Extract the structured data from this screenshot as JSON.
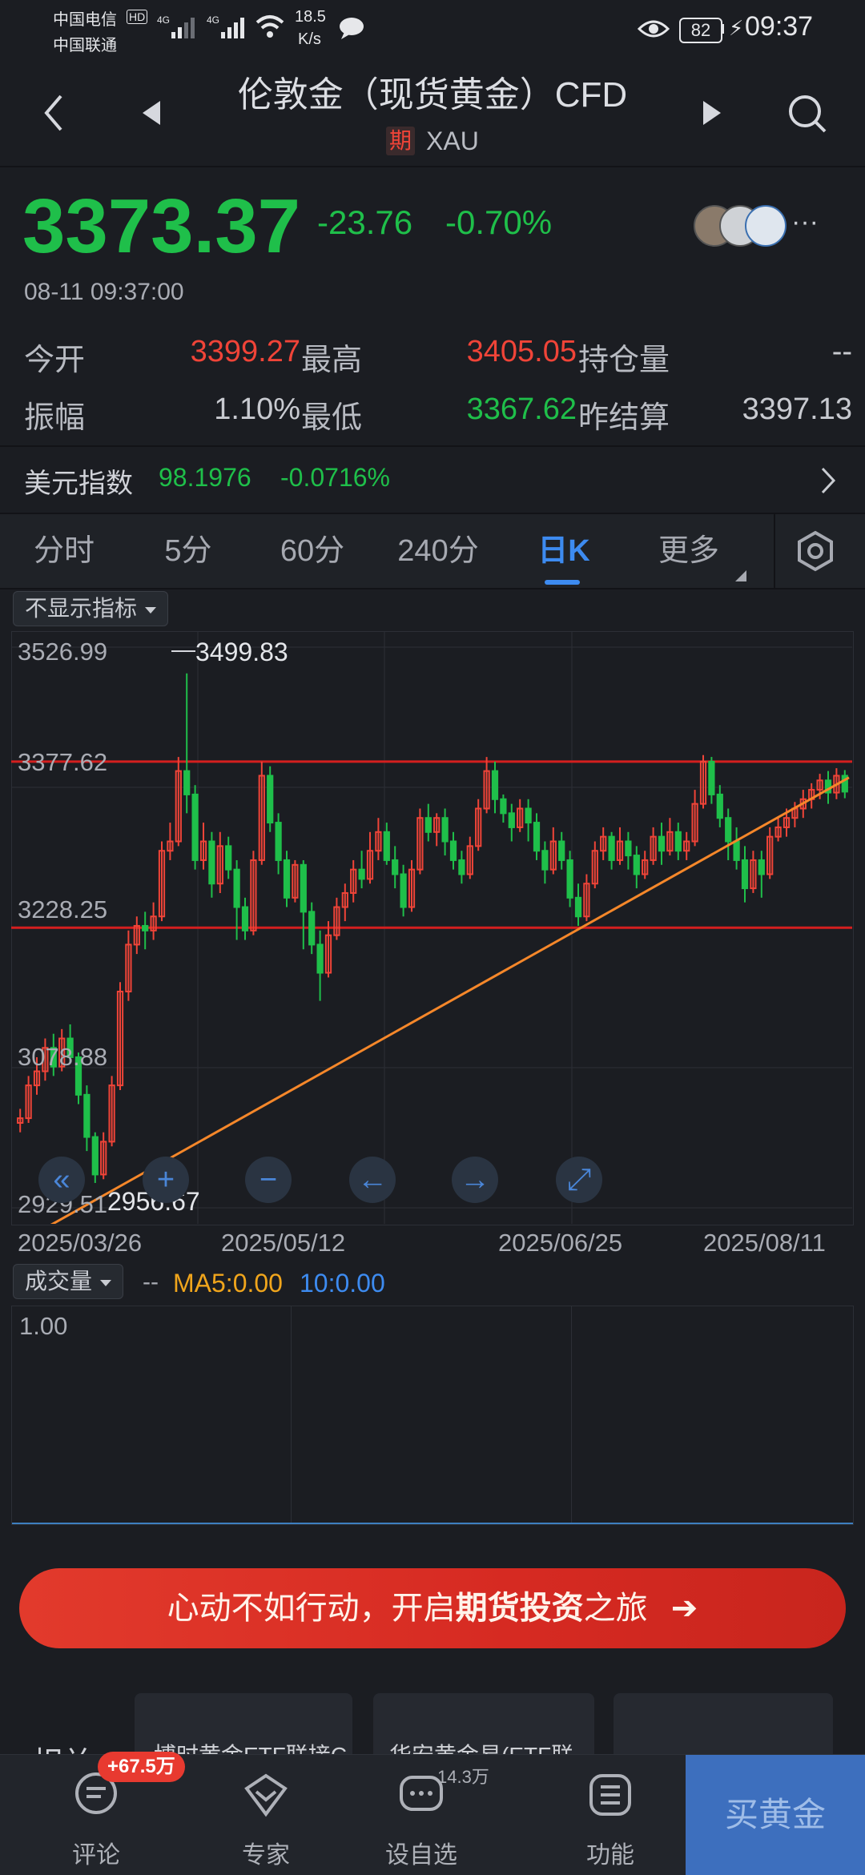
{
  "status_bar": {
    "carrier1": "中国电信",
    "carrier2": "中国联通",
    "hd": "HD",
    "net1": "4G",
    "net2": "4G",
    "speed_value": "18.5",
    "speed_unit": "K/s",
    "battery": "82",
    "time": "09:37"
  },
  "header": {
    "title": "伦敦金（现货黄金）CFD",
    "badge": "期",
    "code": "XAU"
  },
  "quote": {
    "price": "3373.37",
    "change": "-23.76",
    "change_pct": "-0.70%",
    "timestamp": "08-11 09:37:00",
    "more": "···",
    "stats": [
      {
        "label": "今开",
        "value": "3399.27",
        "color": "#f04438"
      },
      {
        "label": "最高",
        "value": "3405.05",
        "color": "#f04438"
      },
      {
        "label": "持仓量",
        "value": "--",
        "color": "#c8cad0"
      },
      {
        "label": "振幅",
        "value": "1.10%",
        "color": "#c8cad0"
      },
      {
        "label": "最低",
        "value": "3367.62",
        "color": "#1fbf4a"
      },
      {
        "label": "昨结算",
        "value": "3397.13",
        "color": "#c8cad0"
      }
    ]
  },
  "usd_index": {
    "label": "美元指数",
    "value": "98.1976",
    "change": "-0.0716%"
  },
  "tabs": [
    "分时",
    "5分",
    "60分",
    "240分",
    "日K",
    "更多"
  ],
  "active_tab": "日K",
  "indicator_select": "不显示指标",
  "chart_data": {
    "type": "candlestick",
    "ylim": [
      2929.51,
      3526.99
    ],
    "y_ticks": [
      "3526.99",
      "3377.62",
      "3228.25",
      "3078.88",
      "2929.51"
    ],
    "x_ticks": [
      "2025/03/26",
      "2025/05/12",
      "2025/06/25",
      "2025/08/11"
    ],
    "max_label": "3499.83",
    "min_label": "2956.67",
    "resistance": 3405,
    "support": 3228,
    "up_color": "#f04438",
    "down_color": "#1fbf4a",
    "trendline_color": "#f5872a",
    "trendline": [
      [
        0,
        2900
      ],
      [
        1.0,
        3388
      ]
    ],
    "candles": [
      [
        3020,
        3025,
        3010,
        3035
      ],
      [
        3025,
        3060,
        3020,
        3070
      ],
      [
        3060,
        3075,
        3050,
        3090
      ],
      [
        3075,
        3100,
        3065,
        3110
      ],
      [
        3100,
        3080,
        3070,
        3115
      ],
      [
        3080,
        3110,
        3075,
        3120
      ],
      [
        3110,
        3090,
        3085,
        3125
      ],
      [
        3090,
        3050,
        3040,
        3095
      ],
      [
        3050,
        3005,
        2990,
        3060
      ],
      [
        3005,
        2965,
        2956,
        3010
      ],
      [
        2965,
        3000,
        2960,
        3010
      ],
      [
        3000,
        3060,
        2995,
        3070
      ],
      [
        3060,
        3160,
        3055,
        3170
      ],
      [
        3160,
        3210,
        3150,
        3225
      ],
      [
        3210,
        3230,
        3200,
        3240
      ],
      [
        3230,
        3225,
        3205,
        3245
      ],
      [
        3225,
        3240,
        3215,
        3255
      ],
      [
        3240,
        3310,
        3235,
        3320
      ],
      [
        3310,
        3320,
        3300,
        3340
      ],
      [
        3320,
        3395,
        3315,
        3410
      ],
      [
        3395,
        3370,
        3350,
        3499
      ],
      [
        3370,
        3300,
        3290,
        3380
      ],
      [
        3300,
        3320,
        3290,
        3340
      ],
      [
        3320,
        3275,
        3260,
        3330
      ],
      [
        3275,
        3315,
        3265,
        3330
      ],
      [
        3315,
        3290,
        3280,
        3325
      ],
      [
        3290,
        3250,
        3215,
        3300
      ],
      [
        3250,
        3225,
        3215,
        3260
      ],
      [
        3225,
        3300,
        3220,
        3310
      ],
      [
        3300,
        3390,
        3295,
        3405
      ],
      [
        3390,
        3340,
        3330,
        3400
      ],
      [
        3340,
        3300,
        3285,
        3350
      ],
      [
        3300,
        3260,
        3250,
        3310
      ],
      [
        3260,
        3295,
        3255,
        3300
      ],
      [
        3295,
        3245,
        3205,
        3300
      ],
      [
        3245,
        3210,
        3200,
        3255
      ],
      [
        3210,
        3180,
        3150,
        3225
      ],
      [
        3180,
        3220,
        3175,
        3235
      ],
      [
        3220,
        3250,
        3215,
        3260
      ],
      [
        3250,
        3265,
        3235,
        3275
      ],
      [
        3265,
        3290,
        3255,
        3300
      ],
      [
        3290,
        3280,
        3270,
        3310
      ],
      [
        3280,
        3310,
        3275,
        3330
      ],
      [
        3310,
        3330,
        3300,
        3345
      ],
      [
        3330,
        3300,
        3295,
        3340
      ],
      [
        3300,
        3285,
        3270,
        3315
      ],
      [
        3285,
        3250,
        3240,
        3295
      ],
      [
        3250,
        3290,
        3245,
        3300
      ],
      [
        3290,
        3345,
        3285,
        3355
      ],
      [
        3345,
        3330,
        3320,
        3360
      ],
      [
        3330,
        3345,
        3315,
        3350
      ],
      [
        3345,
        3320,
        3305,
        3355
      ],
      [
        3320,
        3300,
        3290,
        3330
      ],
      [
        3300,
        3285,
        3275,
        3310
      ],
      [
        3285,
        3315,
        3280,
        3325
      ],
      [
        3315,
        3355,
        3310,
        3365
      ],
      [
        3355,
        3395,
        3350,
        3410
      ],
      [
        3395,
        3365,
        3350,
        3405
      ],
      [
        3365,
        3350,
        3340,
        3370
      ],
      [
        3350,
        3335,
        3320,
        3360
      ],
      [
        3335,
        3355,
        3330,
        3365
      ],
      [
        3355,
        3340,
        3320,
        3365
      ],
      [
        3340,
        3310,
        3300,
        3350
      ],
      [
        3310,
        3290,
        3275,
        3320
      ],
      [
        3290,
        3320,
        3285,
        3335
      ],
      [
        3320,
        3300,
        3290,
        3330
      ],
      [
        3300,
        3260,
        3250,
        3310
      ],
      [
        3260,
        3240,
        3230,
        3275
      ],
      [
        3240,
        3275,
        3235,
        3285
      ],
      [
        3275,
        3310,
        3270,
        3320
      ],
      [
        3310,
        3325,
        3300,
        3335
      ],
      [
        3325,
        3300,
        3290,
        3330
      ],
      [
        3300,
        3320,
        3295,
        3335
      ],
      [
        3320,
        3305,
        3290,
        3330
      ],
      [
        3305,
        3285,
        3270,
        3315
      ],
      [
        3285,
        3300,
        3280,
        3310
      ],
      [
        3300,
        3325,
        3295,
        3335
      ],
      [
        3325,
        3310,
        3295,
        3340
      ],
      [
        3310,
        3330,
        3305,
        3345
      ],
      [
        3330,
        3310,
        3300,
        3340
      ],
      [
        3310,
        3320,
        3300,
        3330
      ],
      [
        3320,
        3360,
        3315,
        3375
      ],
      [
        3360,
        3405,
        3355,
        3412
      ],
      [
        3405,
        3370,
        3360,
        3410
      ],
      [
        3370,
        3345,
        3335,
        3380
      ],
      [
        3345,
        3320,
        3300,
        3355
      ],
      [
        3320,
        3300,
        3290,
        3335
      ],
      [
        3300,
        3270,
        3255,
        3315
      ],
      [
        3270,
        3300,
        3265,
        3310
      ],
      [
        3300,
        3285,
        3260,
        3310
      ],
      [
        3285,
        3325,
        3280,
        3335
      ],
      [
        3325,
        3335,
        3320,
        3345
      ],
      [
        3335,
        3345,
        3325,
        3355
      ],
      [
        3345,
        3355,
        3335,
        3362
      ],
      [
        3355,
        3365,
        3345,
        3375
      ],
      [
        3365,
        3375,
        3355,
        3382
      ],
      [
        3375,
        3385,
        3365,
        3392
      ],
      [
        3385,
        3372,
        3360,
        3395
      ],
      [
        3372,
        3390,
        3365,
        3398
      ],
      [
        3390,
        3373,
        3366,
        3396
      ]
    ]
  },
  "zoom_buttons": [
    "«",
    "+",
    "−",
    "←",
    "→",
    "⤢"
  ],
  "volume": {
    "select": "成交量",
    "dash": "--",
    "ma5": "MA5:0.00",
    "ma10": "10:0.00",
    "top_value": "1.00"
  },
  "banner": {
    "text_a": "心动不如行动，开启",
    "text_b": "期货投资",
    "text_c": "之旅"
  },
  "related": {
    "label": "相关",
    "cards": [
      "博时黄金ETF联接C",
      "华安黄金易(ETF联",
      ""
    ]
  },
  "bottom_nav": {
    "comment": "评论",
    "comment_badge": "+67.5万",
    "expert": "专家",
    "watch": "设自选",
    "watch_count": "14.3万",
    "func": "功能",
    "buy": "买黄金"
  }
}
